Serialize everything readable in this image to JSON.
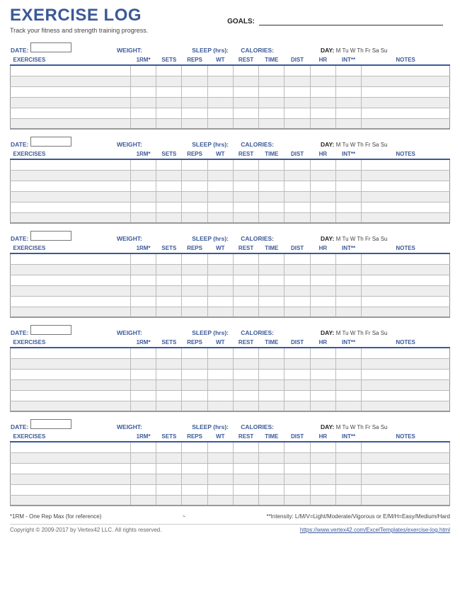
{
  "header": {
    "title": "EXERCISE LOG",
    "goals_label": "GOALS:",
    "subtitle": "Track your fitness and strength training progress."
  },
  "block": {
    "date_label": "DATE:",
    "weight_label": "WEIGHT:",
    "sleep_label": "SLEEP (hrs):",
    "calories_label": "CALORIES:",
    "day_label": "DAY:",
    "days": "M  Tu  W  Th  Fr  Sa  Su"
  },
  "columns": {
    "exercises": "EXERCISES",
    "rm": "1RM*",
    "sets": "SETS",
    "reps": "REPS",
    "wt": "WT",
    "rest": "REST",
    "time": "TIME",
    "dist": "DIST",
    "hr": "HR",
    "int": "INT**",
    "notes": "NOTES"
  },
  "footnotes": {
    "left": "*1RM - One Rep Max (for reference)",
    "mid": "~",
    "right": "**Intensity: L/M/V=Light/Moderate/Vigorous or E/M/H=Easy/Medium/Hard"
  },
  "footer": {
    "copyright": "Copyright © 2009-2017 by Vertex42 LLC. All rights reserved.",
    "url": "https://www.vertex42.com/ExcelTemplates/exercise-log.html"
  }
}
